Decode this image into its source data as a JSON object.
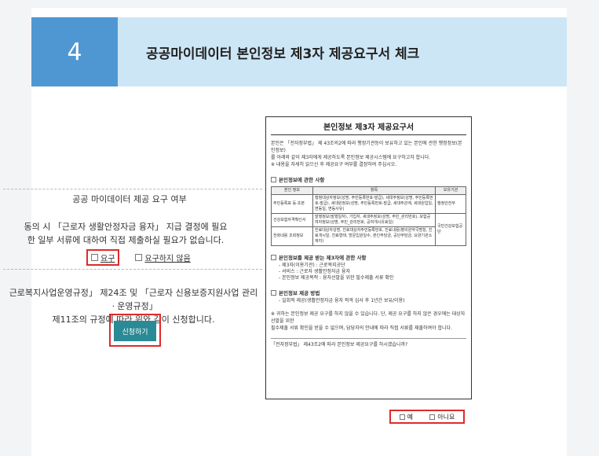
{
  "header": {
    "step_number": "4",
    "title": "공공마이데이터 본인정보 제3자 제공요구서 체크"
  },
  "consent": {
    "title": "공공 마이데이터 제공 요구 여부",
    "line1": "동의 시 「근로자 생활안정자금 융자」 지급 결정에 필요",
    "line2": "한 일부 서류에 대하여 직접 제출하실 필요가 없습니다.",
    "option_yes": "요구",
    "option_no": "요구하지 않음"
  },
  "apply": {
    "line1": "근로복지사업운영규정」 제24조 및 「근로자 신용보증지원사업 관리ㆍ운영규정」",
    "line2": "제11조의 규정에 따라 위와 같이 신청합니다.",
    "button_label": "신청하기"
  },
  "form": {
    "title": "본인정보 제3자 제공요구서",
    "intro_1": "본인은 「전자정부법」 제 43조의2에 따라 행정기관등이 보유하고 있는 본인에 관한 행정정보(본인정보)",
    "intro_2": "를 아래와 같이 제3자에게 제공하도록 본인정보 제공시스템에 요구하고자 합니다.",
    "intro_3": "※ 내용을 자세히 읽으신 후 제공요구 여부를 결정하여 주십시오.",
    "section1": "본인정보에 관한 사항",
    "table_headers": [
      "본인 정보",
      "항목",
      "보유기관"
    ],
    "table_rows": [
      {
        "name": "주민등록표 등·초본",
        "items": "행정대상자정보(성명, 주민등록번호-발급), 세대주정보(성명, 주민등록번호-발급), 세대원정보(성명, 주민등록번호-발급, 세대주관계, 세대원입일, 변동일, 변동사유)",
        "agency": "행정안전부"
      },
      {
        "name": "건강보험자격확인서",
        "items": "발행정보(발행일자), 가입자, 세대주정보(성명, 주민_관리번호), 보험공여자정보(성명, 주민_관리번호, 공여개시유효일)",
        "agency": "국민건강보험공단"
      },
      {
        "name": "전화내용 조회정보",
        "items": "진료대상자성명, 진료대상자주민등록번호, 진료내용(병의원약국명칭, 진료개시일, 진료형태, 방문입원일수, 본인부담금, 공단부담금, 요양기관소재지)",
        "agency": ""
      }
    ],
    "section2": "본인정보를 제공 받는 제3자에 관한 사항",
    "sec2_items": [
      "- 제3자(이용기관) : 근로복지공단",
      "- 서비스 : 근로자 생활안정자금 융자",
      "- 본인정보 제공목적 : 융자선발을 위한 필수제출 서류 확인"
    ],
    "section3": "본인정보 제공 방법",
    "sec3_items": [
      "- 일회적 제공(생활안정자금 융자 적격 심사 후 1년간 보유/이용)"
    ],
    "note_1": "※ 귀하는 본인정보 제공 요구를 하지 않을 수 있습니다. 단, 제공 요구를 하지 않은 경우에는 대상자 선발을 위한",
    "note_2": "필수제출 서류 확인을 받을 수 없으며, 담당자의 안내에 따라 직접 서류를 제출하여야 합니다.",
    "question": "「전자정부법」 제43조2에 따라 본인정보 제공요구를 하시겠습니까?",
    "answer_yes": "예",
    "answer_no": "아니요"
  },
  "colors": {
    "header_num_bg": "#4f97d2",
    "header_bg": "#cde6f6",
    "button_bg": "#2a8a95",
    "highlight_border": "#e02a2a"
  }
}
